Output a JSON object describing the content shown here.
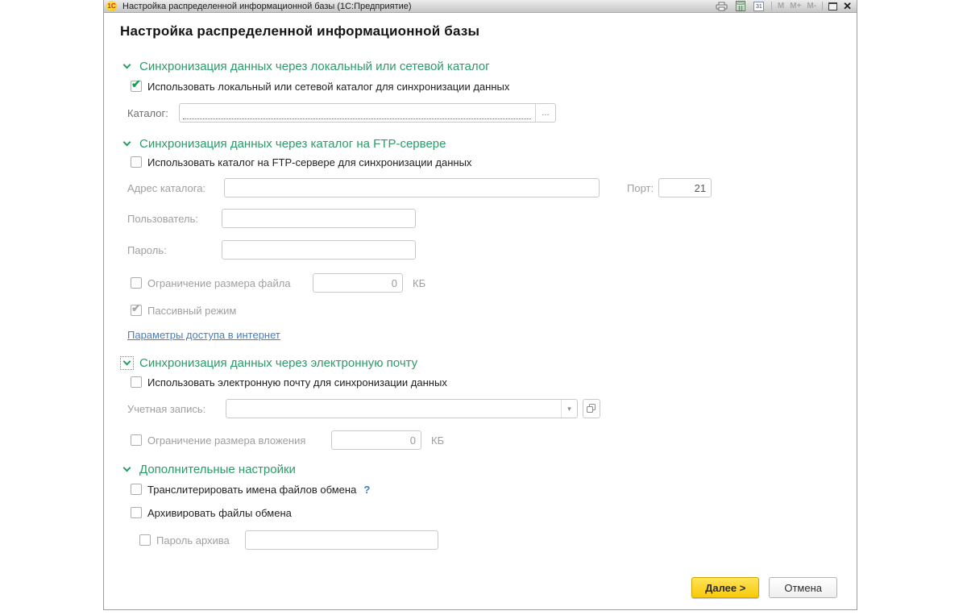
{
  "titlebar": {
    "logo": "1С",
    "title": "Настройка распределенной информационной базы  (1С:Предприятие)",
    "calendar": "31",
    "memory_m": "M",
    "memory_m_plus": "M+",
    "memory_m_minus": "M-",
    "close": "✕"
  },
  "page": {
    "heading": "Настройка распределенной информационной базы"
  },
  "glyphs": {
    "check": "✔",
    "dropdown": "▾",
    "browse": "...",
    "help": "?"
  },
  "sections": {
    "local": {
      "title": "Синхронизация данных через локальный или сетевой каталог",
      "use_label": "Использовать локальный или сетевой каталог для синхронизации данных",
      "catalog_label": "Каталог:",
      "catalog_value": ""
    },
    "ftp": {
      "title": "Синхронизация данных через каталог на FTP-сервере",
      "use_label": "Использовать каталог на FTP-сервере для синхронизации данных",
      "address_label": "Адрес каталога:",
      "address_value": "",
      "port_label": "Порт:",
      "port_value": "21",
      "user_label": "Пользователь:",
      "user_value": "",
      "password_label": "Пароль:",
      "password_value": "",
      "filesize_label": "Ограничение размера файла",
      "filesize_value": "0",
      "filesize_unit": "КБ",
      "passive_label": "Пассивный режим",
      "internet_link": "Параметры доступа в интернет"
    },
    "email": {
      "title": "Синхронизация данных через электронную почту",
      "use_label": "Использовать электронную почту для синхронизации данных",
      "account_label": "Учетная запись:",
      "account_value": "",
      "attach_label": "Ограничение размера вложения",
      "attach_value": "0",
      "attach_unit": "КБ"
    },
    "extra": {
      "title": "Дополнительные настройки",
      "translit_label": "Транслитерировать имена файлов обмена",
      "archive_label": "Архивировать файлы обмена",
      "archive_password_label": "Пароль архива",
      "archive_password_value": ""
    }
  },
  "footer": {
    "next": "Далее >",
    "cancel": "Отмена"
  },
  "colors": {
    "section_green": "#2b9b68",
    "check_green": "#0ca34e",
    "link_blue": "#4a7ebb",
    "required_red": "#cc3b3b",
    "next_yellow": "#f8ca07"
  }
}
